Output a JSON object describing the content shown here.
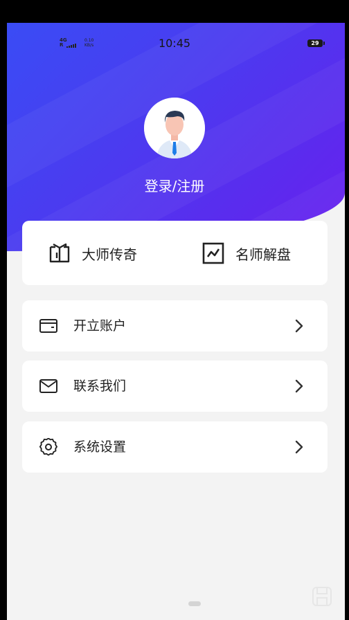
{
  "status_bar": {
    "network": "4G",
    "network_sub": "R",
    "speed_value": "0.10",
    "speed_unit": "KB/s",
    "time": "10:45",
    "battery": "29"
  },
  "profile": {
    "login_label": "登录/注册"
  },
  "quick_actions": [
    {
      "label": "大师传奇",
      "icon": "book-icon"
    },
    {
      "label": "名师解盘",
      "icon": "chart-icon"
    }
  ],
  "menu": [
    {
      "label": "开立账户",
      "icon": "wallet-icon"
    },
    {
      "label": "联系我们",
      "icon": "mail-icon"
    },
    {
      "label": "系统设置",
      "icon": "gear-icon"
    }
  ],
  "colors": {
    "hero_start": "#3a4cf5",
    "hero_end": "#6a1ff0",
    "background": "#f3f3f3",
    "card": "#ffffff"
  }
}
